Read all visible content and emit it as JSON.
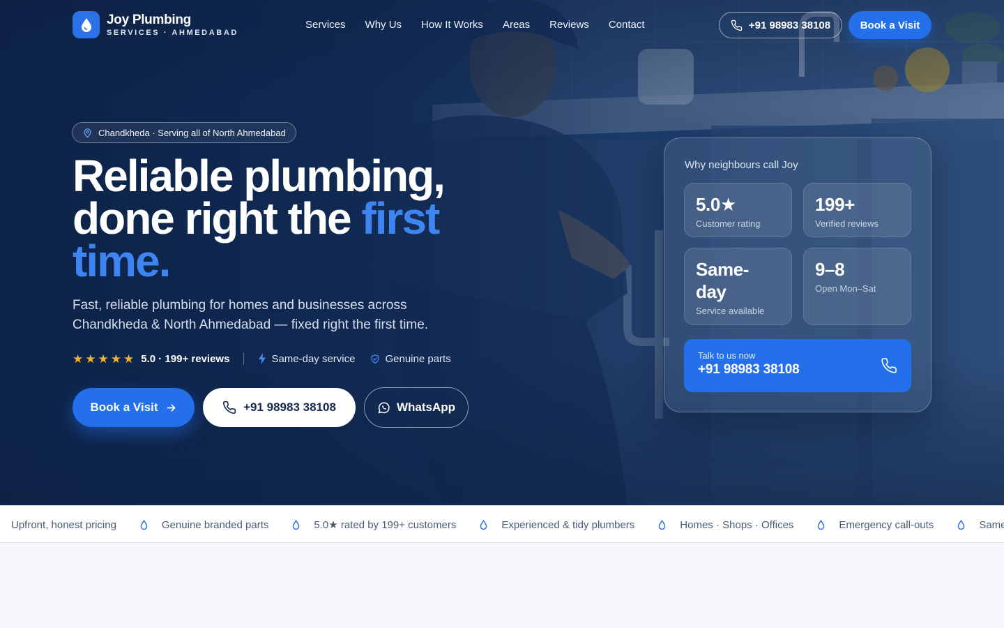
{
  "brand": {
    "name": "Joy Plumbing",
    "subtitle": "SERVICES · AHMEDABAD"
  },
  "nav": {
    "links": [
      "Services",
      "Why Us",
      "How It Works",
      "Areas",
      "Reviews",
      "Contact"
    ],
    "phone": "+91 98983 38108",
    "book_label": "Book a Visit"
  },
  "hero": {
    "location_pill": "Chandkheda · Serving all of North Ahmedabad",
    "headline_line1": "Reliable plumbing,",
    "headline_line2": "done right the ",
    "headline_accent": "first",
    "headline_line3": "time.",
    "lead": "Fast, reliable plumbing for homes and businesses across Chandkheda & North Ahmedabad — fixed right the first time.",
    "rating_text": "5.0 · 199+ reviews",
    "star_count": 5,
    "feature1": "Same-day service",
    "feature2": "Genuine parts",
    "cta_book": "Book a Visit",
    "cta_phone": "+91 98983 38108",
    "cta_whatsapp": "WhatsApp"
  },
  "stats_card": {
    "title": "Why neighbours call Joy",
    "tiles": [
      {
        "value": "5.0★",
        "label": "Customer rating"
      },
      {
        "value": "199+",
        "label": "Verified reviews"
      },
      {
        "value": "Same-day",
        "label": "Service available"
      },
      {
        "value": "9–8",
        "label": "Open Mon–Sat"
      }
    ],
    "talk_label": "Talk to us now",
    "talk_phone": "+91 98983 38108"
  },
  "marquee": [
    "Upfront, honest pricing",
    "Genuine branded parts",
    "5.0★ rated by 199+ customers",
    "Experienced & tidy plumbers",
    "Homes · Shops · Offices",
    "Emergency call-outs",
    "Same-day"
  ],
  "colors": {
    "accent": "#2370ea",
    "accent_text": "#3f85f1",
    "star": "#f7b02a",
    "hero_bg": "#143463"
  }
}
